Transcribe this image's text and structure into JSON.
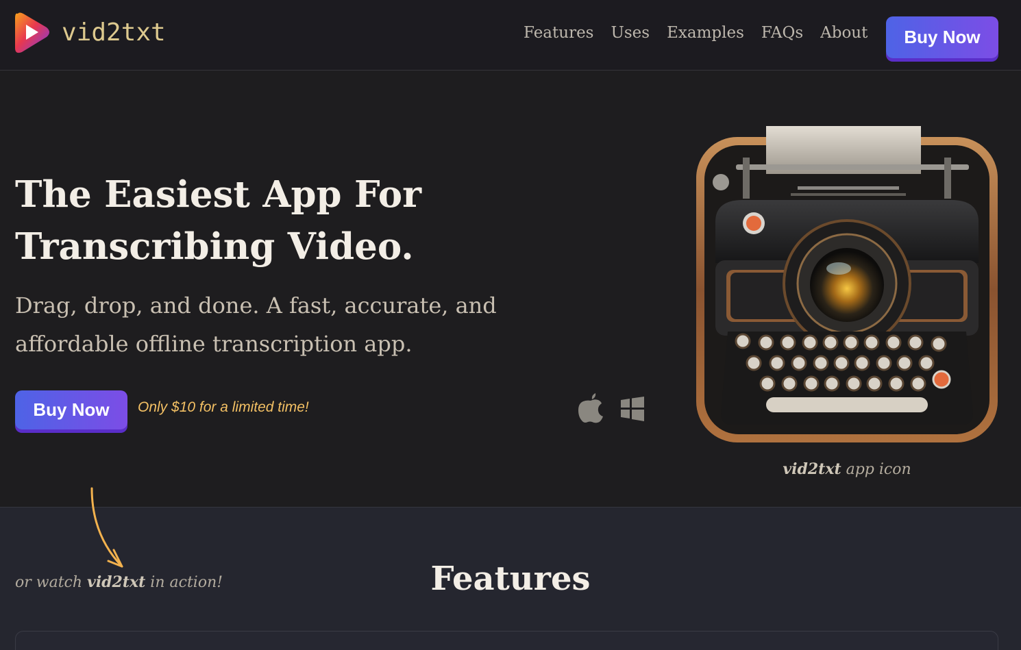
{
  "header": {
    "logo_text": "vid2txt",
    "logo_icon": "play-logo-icon",
    "nav": [
      "Features",
      "Uses",
      "Examples",
      "FAQs",
      "About"
    ],
    "buy_label": "Buy Now"
  },
  "hero": {
    "title_line1": "The Easiest App For",
    "title_line2": "Transcribing Video.",
    "subtitle": "Drag, drop, and done. A fast, accurate, and affordable offline transcription app.",
    "buy_label": "Buy Now",
    "promo": "Only $10 for a limited time!",
    "platform_icons": [
      "apple-icon",
      "windows-icon"
    ],
    "caption_brand": "vid2txt",
    "caption_rest": " app icon"
  },
  "features": {
    "watch_prefix": "or watch ",
    "watch_brand": "vid2txt",
    "watch_suffix": " in action!",
    "title": "Features"
  },
  "colors": {
    "accent_gradient_start": "#4e63e6",
    "accent_gradient_end": "#7c4de6",
    "promo": "#f3c064",
    "logo_text": "#ddc98e"
  }
}
